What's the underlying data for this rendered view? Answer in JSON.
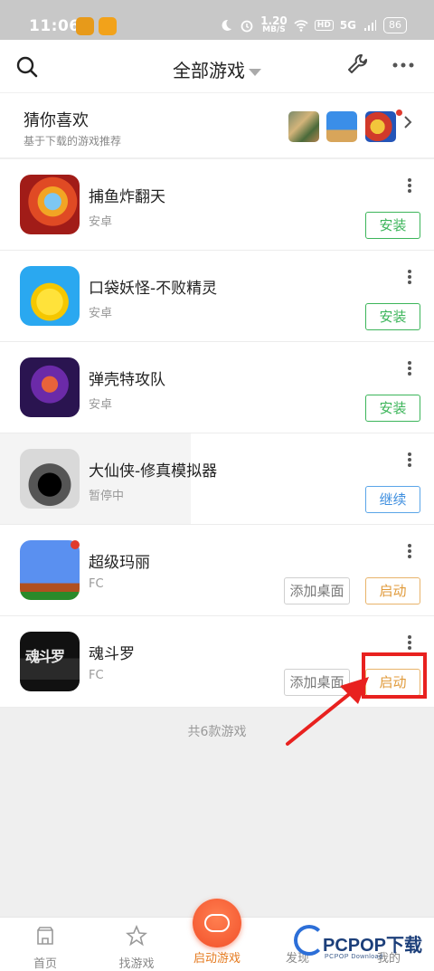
{
  "status_bar": {
    "time": "11:06",
    "net_speed_value": "1.20",
    "net_speed_unit": "MB/S",
    "hd": "HD",
    "signal": "5G",
    "battery": "86"
  },
  "header": {
    "title": "全部游戏"
  },
  "recommend": {
    "title": "猜你喜欢",
    "subtitle": "基于下载的游戏推荐"
  },
  "games": [
    {
      "name": "捕鱼炸翻天",
      "platform": "安卓",
      "action": "安装"
    },
    {
      "name": "口袋妖怪-不败精灵",
      "platform": "安卓",
      "action": "安装"
    },
    {
      "name": "弹壳特攻队",
      "platform": "安卓",
      "action": "安装"
    },
    {
      "name": "大仙侠-修真模拟器",
      "platform": "暂停中",
      "action": "继续"
    },
    {
      "name": "超级玛丽",
      "platform": "FC",
      "secondary_action": "添加桌面",
      "action": "启动"
    },
    {
      "name": "魂斗罗",
      "platform": "FC",
      "secondary_action": "添加桌面",
      "action": "启动",
      "icon_text": "魂斗罗"
    }
  ],
  "total": "共6款游戏",
  "nav": {
    "home": "首页",
    "find": "找游戏",
    "launch": "启动游戏",
    "discover": "发现",
    "mine": "我的"
  },
  "watermark": {
    "brand": "PCPOP下载",
    "sub": "PCPOP Download"
  },
  "colors": {
    "install_green": "#3cb55a",
    "continue_blue": "#3f8fdf",
    "launch_orange": "#e09a3a",
    "active_nav": "#e57a1f",
    "highlight_red": "#e8211f"
  }
}
